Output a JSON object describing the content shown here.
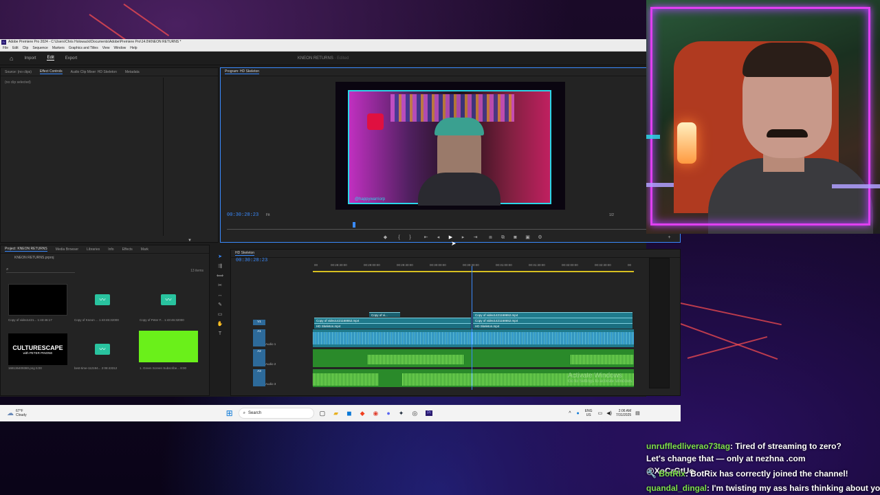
{
  "window": {
    "title": "Adobe Premiere Pro 2024 - C:\\Users\\Chris Holowacki\\Documents\\Adobe\\Premiere Pro\\14.0\\KNEON RETURNS *",
    "menu": [
      "File",
      "Edit",
      "Clip",
      "Sequence",
      "Markers",
      "Graphics and Titles",
      "View",
      "Window",
      "Help"
    ]
  },
  "workspace": {
    "home": "Home",
    "import": "Import",
    "edit": "Edit",
    "export": "Export",
    "project_title": "KNEON RETURNS",
    "edited": "- Edited"
  },
  "source_panel": {
    "tabs": [
      "Source: (no clips)",
      "Effect Controls",
      "Audio Clip Mixer: HD Skeleton",
      "Metadata"
    ],
    "active": "Effect Controls",
    "empty": "(no clip selected)"
  },
  "program": {
    "tab": "Program: HD Skeleton",
    "timecode": "00:30:28:23",
    "fit": "Fit",
    "resolution": "1/2",
    "tag": "@happywarriorp"
  },
  "project": {
    "tabs": [
      "Project: KNEON RETURNS",
      "Media Browser",
      "Libraries",
      "Info",
      "Effects",
      "Mark"
    ],
    "file": "KNEON RETURNS.prproj",
    "count": "13 items",
    "items": [
      {
        "name": "Copy of video1421...",
        "dur": "1:43:46:17"
      },
      {
        "name": "Copy of Kneon ...",
        "dur": "1:43:46:32000"
      },
      {
        "name": "Copy of Peter F...",
        "dur": "1:43:46:32000"
      },
      {
        "name": "168136409380.png",
        "dur": "5:00"
      },
      {
        "name": "best-time-112194...",
        "dur": "2:08:43312"
      },
      {
        "name": "1. Green Screen Subscribe...",
        "dur": "8:00"
      }
    ],
    "logo_line1": "CULTURESCAPE",
    "logo_line2": "with PETER PINONE"
  },
  "timeline": {
    "tab": "HD Skeleton",
    "timecode": "00:30:28:23",
    "ruler": [
      "00",
      "00:28:30:00",
      "00:29:00:00",
      "00:29:30:00",
      "00:30:00:00",
      "00:30:30:00",
      "00:31:00:00",
      "00:31:30:00",
      "00:32:00:00",
      "00:32:30:00",
      "00"
    ],
    "tracks": {
      "v4": "V4",
      "v3": "V3",
      "v2": "V2",
      "v1": "V1",
      "a1": "A1",
      "a2": "A2",
      "a3": "A3",
      "audio1": "Audio 1",
      "audio2": "Audio 2",
      "audio3": "Audio 3"
    },
    "clips": {
      "v2a": "Copy of vi...",
      "v1a": "Copy of video1421168652.mp4",
      "v1b": "Copy of video1421168652.mp4",
      "v1c": "Copy of video1421168652.mp4",
      "v1d": "Copy of video1421168652.mp4",
      "sk1": "HD Skeleton.mp4",
      "sk2": "HD Skeleton.mp4"
    },
    "activate": "Activate Windows",
    "activate_sub": "Go to Settings to activate Windows."
  },
  "taskbar": {
    "weather_temp": "67°F",
    "weather_desc": "Cloudy",
    "search": "Search",
    "lang1": "ENG",
    "lang2": "US",
    "time": "2:06 AM",
    "date": "7/31/2025"
  },
  "chat": [
    {
      "user": "unruffledliverao73tag",
      "user_color": "#7de04a",
      "msg": ": Tired of streaming to zero? Let's change that — only at nezhna .com @XoCrGtUo"
    },
    {
      "user": "BotRix",
      "user_color": "#7de04a",
      "msg": ": BotRix has correctly joined the channel!"
    },
    {
      "user": "quandal_dingal",
      "user_color": "#7de04a",
      "msg": ": I'm twisting my ass hairs thinking about you"
    }
  ],
  "colors": {
    "accent": "#3a8bff",
    "clip_video": "#1f7a8c",
    "clip_audio": "#5cc43a",
    "waveform_blue": "#4ab8ff",
    "frame": "#e040f0"
  }
}
